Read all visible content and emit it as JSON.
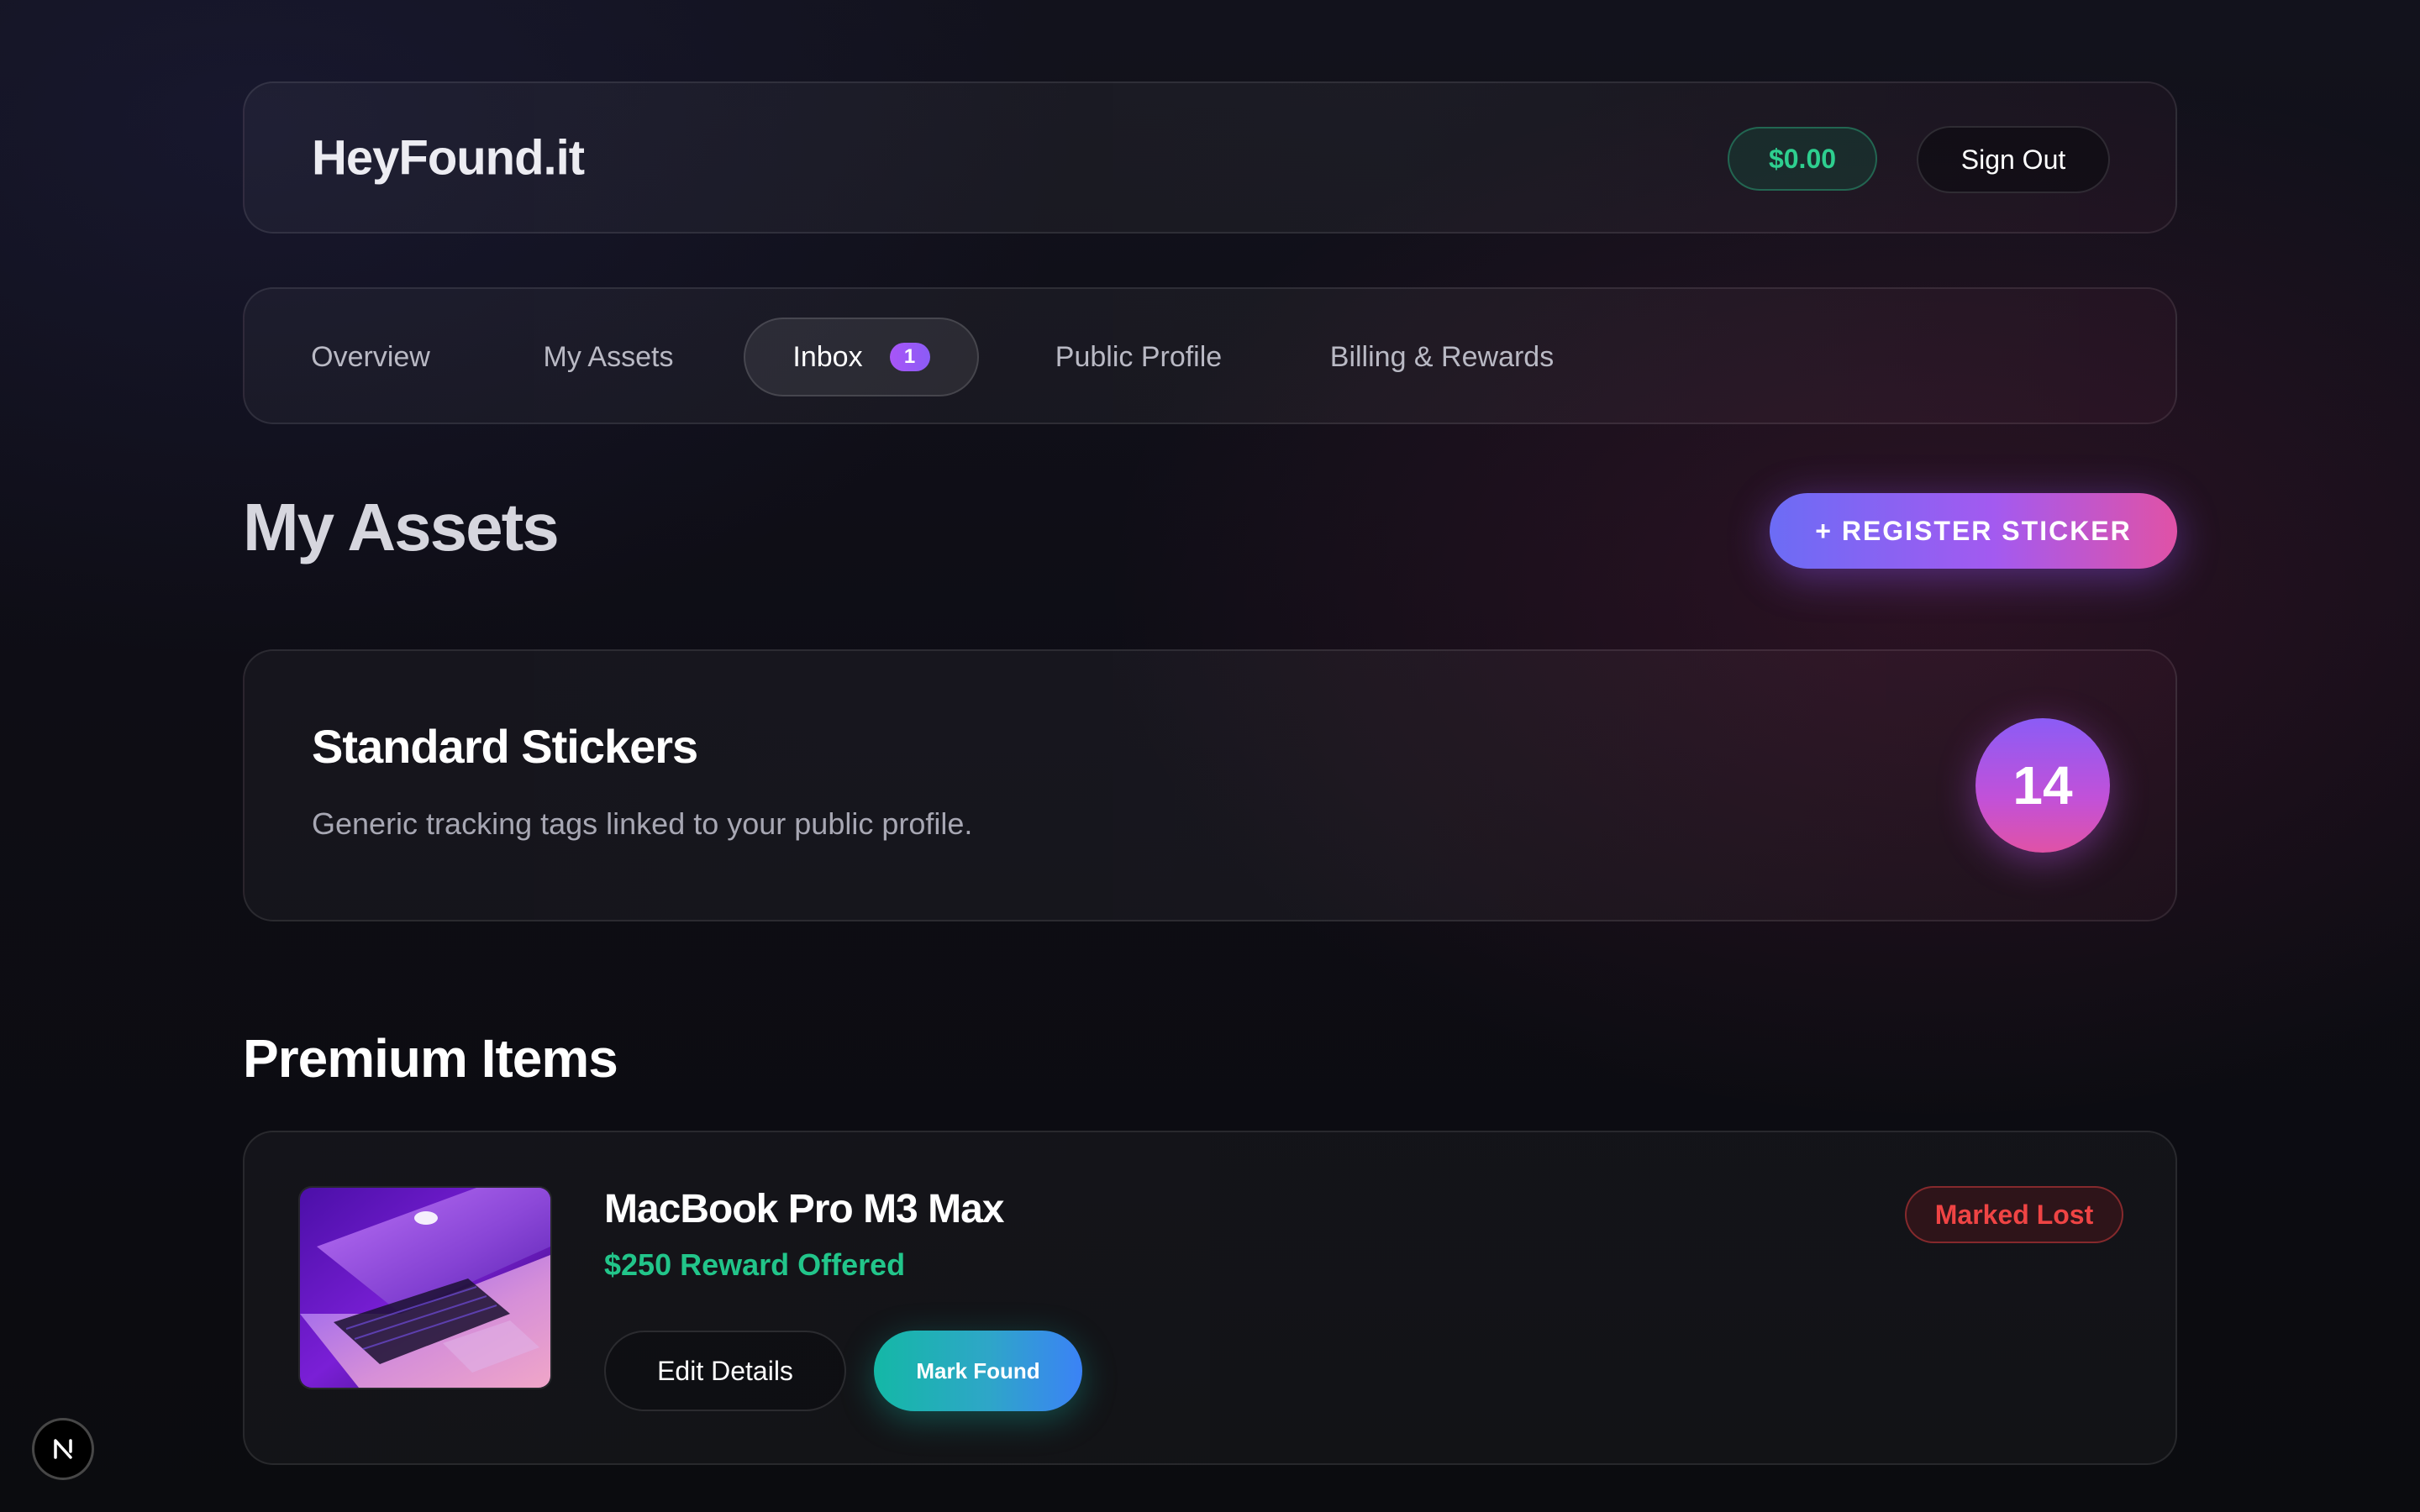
{
  "header": {
    "brand": "HeyFound.it",
    "balance": "$0.00",
    "sign_out_label": "Sign Out"
  },
  "tabs": [
    {
      "label": "Overview",
      "active": false
    },
    {
      "label": "My Assets",
      "active": false
    },
    {
      "label": "Inbox",
      "active": true,
      "badge": "1"
    },
    {
      "label": "Public Profile",
      "active": false
    },
    {
      "label": "Billing & Rewards",
      "active": false
    }
  ],
  "page": {
    "title": "My Assets",
    "register_label": "+ REGISTER STICKER"
  },
  "standard_stickers": {
    "title": "Standard Stickers",
    "description": "Generic tracking tags linked to your public profile.",
    "count": "14"
  },
  "premium": {
    "section_title": "Premium Items",
    "items": [
      {
        "name": "MacBook Pro M3 Max",
        "reward": "$250 Reward Offered",
        "status": "Marked Lost",
        "edit_label": "Edit Details",
        "found_label": "Mark Found",
        "thumbnail": "laptop-photo"
      }
    ]
  },
  "dev_indicator": {
    "icon": "nextjs-icon"
  },
  "colors": {
    "accent_green": "#22c58a",
    "accent_purple": "#8b5cf6",
    "accent_pink": "#e052a6",
    "status_lost": "#ef4444",
    "teal": "#14b8a6"
  }
}
